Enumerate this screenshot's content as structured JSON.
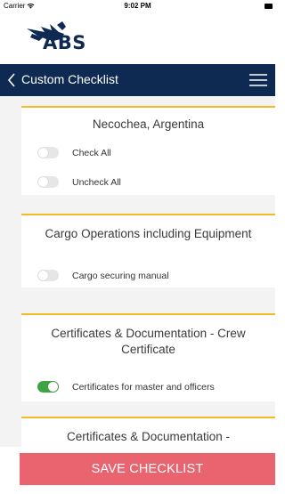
{
  "status_bar": {
    "carrier": "Carrier",
    "time": "9:02 PM"
  },
  "brand": {
    "logo_text": "ABS"
  },
  "header": {
    "title": "Custom Checklist"
  },
  "cards": [
    {
      "title": "Necochea, Argentina",
      "items": [
        {
          "label": "Check All",
          "checked": false
        },
        {
          "label": "Uncheck All",
          "checked": false
        }
      ]
    },
    {
      "title": "Cargo Operations including Equipment",
      "items": [
        {
          "label": "Cargo securing manual",
          "checked": false
        }
      ]
    },
    {
      "title": "Certificates & Documentation - Crew Certificate",
      "items": [
        {
          "label": "Certificates for master and officers",
          "checked": true
        }
      ]
    },
    {
      "title": "Certificates & Documentation -",
      "items": []
    }
  ],
  "footer": {
    "save_label": "SAVE CHECKLIST"
  },
  "colors": {
    "nav": "#0e2a52",
    "accent": "#f2b928",
    "toggle_on": "#3fa342",
    "save_button": "#e9646f"
  }
}
